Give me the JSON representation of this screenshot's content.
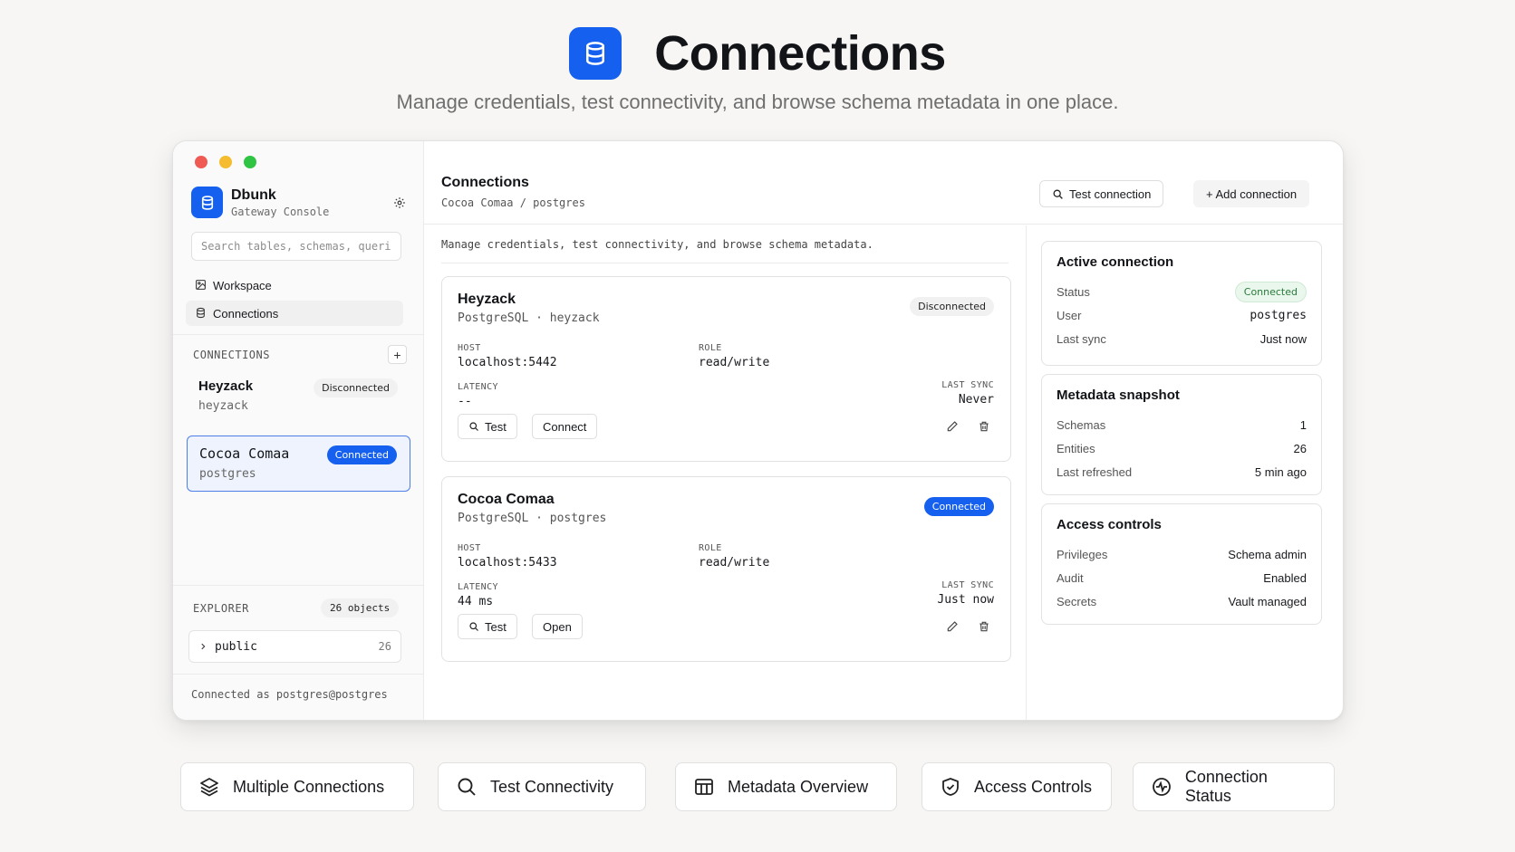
{
  "hero": {
    "title": "Connections",
    "subtitle": "Manage credentials, test connectivity, and browse schema metadata in one place.",
    "logo_icon": "database-icon",
    "accent": "#1560ee"
  },
  "sidebar": {
    "brand_name": "Dbunk",
    "brand_sub": "Gateway Console",
    "search_placeholder": "Search tables, schemas, queries",
    "nav": [
      {
        "label": "Workspace",
        "icon": "image-icon"
      },
      {
        "label": "Connections",
        "icon": "database-icon",
        "active": true
      }
    ],
    "connections_label": "CONNECTIONS",
    "add_label": "+",
    "connections": [
      {
        "name": "Heyzack",
        "user": "heyzack",
        "status": "Disconnected"
      },
      {
        "name": "Cocoa Comaa",
        "user": "postgres",
        "status": "Connected",
        "selected": true
      }
    ],
    "explorer_label": "EXPLORER",
    "explorer_count": "26 objects",
    "tree": [
      {
        "name": "public",
        "count": "26"
      }
    ],
    "footer": "Connected as postgres@postgres"
  },
  "main": {
    "title": "Connections",
    "breadcrumb": "Cocoa Comaa / postgres",
    "test_btn": "Test connection",
    "add_btn": "+ Add connection",
    "description": "Manage credentials, test connectivity, and browse schema metadata.",
    "cards": [
      {
        "title": "Heyzack",
        "subtitle": "PostgreSQL · heyzack",
        "status": "Disconnected",
        "host_label": "HOST",
        "host": "localhost:5442",
        "role_label": "ROLE",
        "role": "read/write",
        "latency_label": "LATENCY",
        "latency": "--",
        "sync_label": "LAST SYNC",
        "sync": "Never",
        "btn_test": "Test",
        "btn_action": "Connect"
      },
      {
        "title": "Cocoa Comaa",
        "subtitle": "PostgreSQL · postgres",
        "status": "Connected",
        "host_label": "HOST",
        "host": "localhost:5433",
        "role_label": "ROLE",
        "role": "read/write",
        "latency_label": "LATENCY",
        "latency": "44 ms",
        "sync_label": "LAST SYNC",
        "sync": "Just now",
        "btn_test": "Test",
        "btn_action": "Open"
      }
    ]
  },
  "panels": {
    "active": {
      "title": "Active connection",
      "rows": [
        {
          "k": "Status",
          "v": "Connected"
        },
        {
          "k": "User",
          "v": "postgres"
        },
        {
          "k": "Last sync",
          "v": "Just now"
        }
      ]
    },
    "metadata": {
      "title": "Metadata snapshot",
      "rows": [
        {
          "k": "Schemas",
          "v": "1"
        },
        {
          "k": "Entities",
          "v": "26"
        },
        {
          "k": "Last refreshed",
          "v": "5 min ago"
        }
      ]
    },
    "access": {
      "title": "Access controls",
      "rows": [
        {
          "k": "Privileges",
          "v": "Schema admin"
        },
        {
          "k": "Audit",
          "v": "Enabled"
        },
        {
          "k": "Secrets",
          "v": "Vault managed"
        }
      ]
    }
  },
  "features": [
    {
      "label": "Multiple Connections",
      "icon": "layers-icon"
    },
    {
      "label": "Test Connectivity",
      "icon": "search-icon"
    },
    {
      "label": "Metadata Overview",
      "icon": "table-icon"
    },
    {
      "label": "Access Controls",
      "icon": "shield-check-icon"
    },
    {
      "label": "Connection Status",
      "icon": "activity-icon"
    }
  ],
  "colors": {
    "accent": "#1560ee",
    "status_green": "#287b3a",
    "window_bg": "#ffffff",
    "page_bg": "#f7f6f4"
  }
}
